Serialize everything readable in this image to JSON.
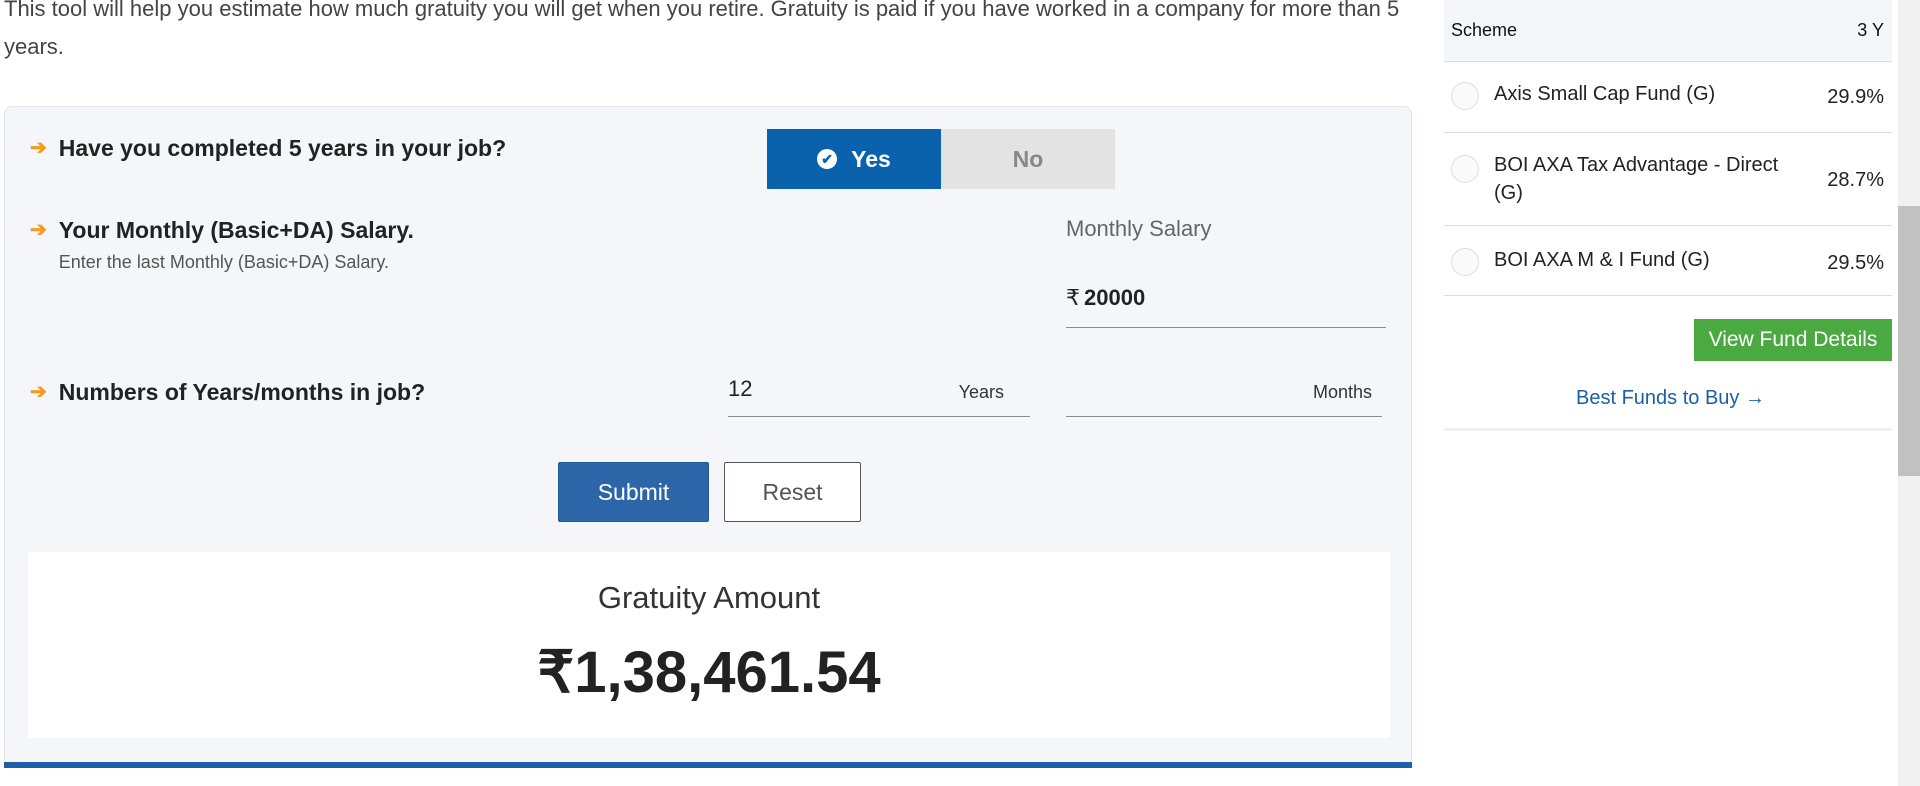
{
  "intro": {
    "text": "This tool will help you estimate how much gratuity you will get when you retire. Gratuity is paid if you have worked in a company for more than 5 years."
  },
  "q1": {
    "text": "Have you completed 5 years in your job?",
    "yes": "Yes",
    "no": "No",
    "selected": "Yes"
  },
  "q2": {
    "text": "Your Monthly (Basic+DA) Salary.",
    "sub": "Enter the last Monthly (Basic+DA) Salary.",
    "field_label": "Monthly Salary",
    "currency": "₹",
    "value": "20000"
  },
  "q3": {
    "text": "Numbers of Years/months in job?",
    "years_value": "12",
    "years_unit": "Years",
    "months_value": "",
    "months_unit": "Months"
  },
  "buttons": {
    "submit": "Submit",
    "reset": "Reset"
  },
  "result": {
    "label": "Gratuity Amount",
    "value": "₹1,38,461.54"
  },
  "sidebar": {
    "header_scheme": "Scheme",
    "header_period": "3 Y",
    "funds": [
      {
        "name": "Axis Small Cap Fund (G)",
        "return": "29.9%"
      },
      {
        "name": "BOI AXA Tax Advantage - Direct (G)",
        "return": "28.7%"
      },
      {
        "name": "BOI AXA M & I Fund (G)",
        "return": "29.5%"
      }
    ],
    "view_button": "View Fund Details",
    "best_link": "Best Funds to Buy →"
  },
  "colors": {
    "primary_blue": "#0a62ad",
    "accent_orange": "#f59a1b",
    "green_button": "#4aaa41"
  }
}
